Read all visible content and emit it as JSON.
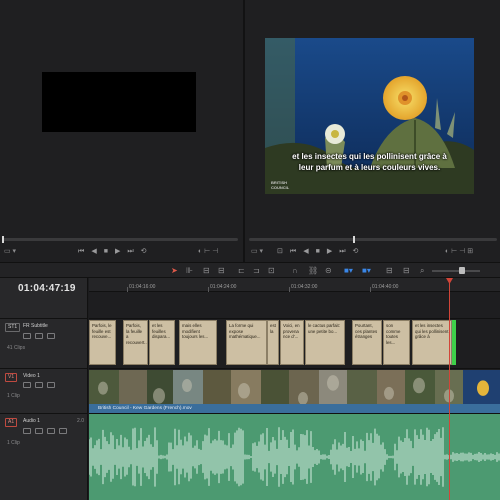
{
  "viewer_left": {
    "name": "source-viewer"
  },
  "program_viewer": {
    "subtitle_line1": "et les insectes qui les pollinisent grâce à",
    "subtitle_line2": "leur parfum et à leurs couleurs vives.",
    "watermark_line1": "BRITISH",
    "watermark_line2": "COUNCIL"
  },
  "transport_icons": [
    "loop-icon",
    "prev-icon",
    "rewind-icon",
    "stop-icon",
    "play-icon",
    "next-icon",
    "loop-toggle-icon"
  ],
  "colors": {
    "accent_red": "#d24538",
    "subtitle_clip": "#cdbfa3",
    "video_label": "#3a6e9c",
    "audio_clip": "#4c9a71",
    "green_marker": "#3ed14a"
  },
  "timeline": {
    "timecode": "01:04:47:19",
    "ruler_labels": [
      "01:04:16:00",
      "01:04:24:00",
      "01:04:32:00",
      "01:04:40:00"
    ],
    "tracks": {
      "subtitle": {
        "badge": "ST1",
        "name": "FR Subtitle",
        "count": "41 Clips"
      },
      "video": {
        "badge": "V1",
        "name": "Video 1",
        "count": "1 Clip"
      },
      "audio": {
        "badge": "A1",
        "name": "Audio 1",
        "count": "1 Clip",
        "level": "2.0"
      }
    },
    "subtitle_clips": [
      "Parfois, le feuille est recouve...",
      "Parfois, la feuille a recouvert...",
      "et les feuilles dispara...",
      "mais elles modifient toujours les...",
      "La forme qui expose mathématique...",
      "est la",
      "Voici, en provena nce d'...",
      "le cactus parfait: une petite bo...",
      "Pourtant, ces plantes étranges",
      "son comme toutes les...",
      "et les insectes qui les pollinisent grâce à"
    ],
    "video_clip_name": "British Council - Kew Gardens (French).mov"
  }
}
